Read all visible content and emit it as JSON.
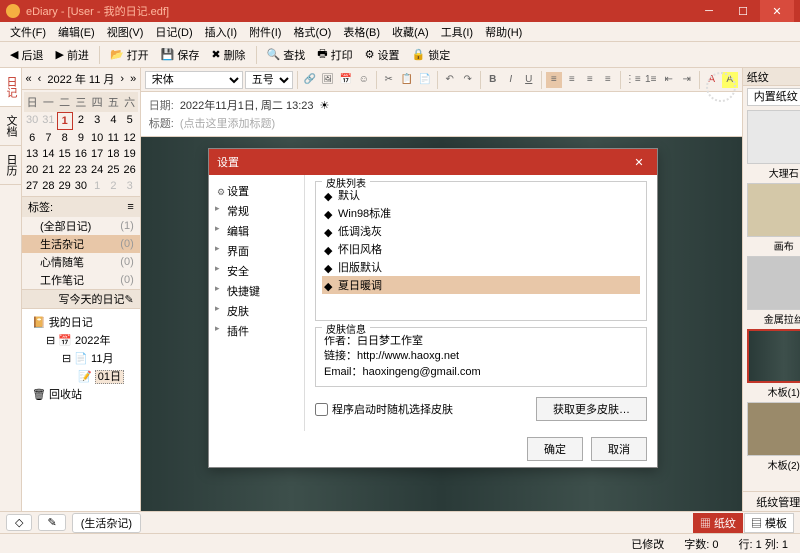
{
  "window": {
    "title": "eDiary - [User - 我的日记.edf]",
    "min": "─",
    "max": "☐",
    "close": "✕"
  },
  "menu": [
    "文件(F)",
    "编辑(E)",
    "视图(V)",
    "日记(D)",
    "插入(I)",
    "附件(I)",
    "格式(O)",
    "表格(B)",
    "收藏(A)",
    "工具(I)",
    "帮助(H)"
  ],
  "toolbar": {
    "back": "后退",
    "fwd": "前进",
    "open": "打开",
    "save": "保存",
    "del": "删除",
    "find": "查找",
    "print": "打印",
    "config": "设置",
    "lock": "锁定"
  },
  "calendar": {
    "title": "2022 年 11 月",
    "weekdays": [
      "日",
      "一",
      "二",
      "三",
      "四",
      "五",
      "六"
    ],
    "cells": [
      {
        "n": 30,
        "dim": true
      },
      {
        "n": 31,
        "dim": true
      },
      {
        "n": 1,
        "today": true
      },
      {
        "n": 2
      },
      {
        "n": 3
      },
      {
        "n": 4
      },
      {
        "n": 5
      },
      {
        "n": 6
      },
      {
        "n": 7
      },
      {
        "n": 8
      },
      {
        "n": 9
      },
      {
        "n": 10
      },
      {
        "n": 11
      },
      {
        "n": 12
      },
      {
        "n": 13
      },
      {
        "n": 14
      },
      {
        "n": 15
      },
      {
        "n": 16
      },
      {
        "n": 17
      },
      {
        "n": 18
      },
      {
        "n": 19
      },
      {
        "n": 20
      },
      {
        "n": 21
      },
      {
        "n": 22
      },
      {
        "n": 23
      },
      {
        "n": 24
      },
      {
        "n": 25
      },
      {
        "n": 26
      },
      {
        "n": 27
      },
      {
        "n": 28
      },
      {
        "n": 29
      },
      {
        "n": 30
      },
      {
        "n": 1,
        "dim": true
      },
      {
        "n": 2,
        "dim": true
      },
      {
        "n": 3,
        "dim": true
      }
    ]
  },
  "tags": {
    "header": "标签:",
    "items": [
      {
        "name": "(全部日记)",
        "count": "(1)"
      },
      {
        "name": "生活杂记",
        "count": "(0)",
        "sel": true
      },
      {
        "name": "心情随笔",
        "count": "(0)"
      },
      {
        "name": "工作笔记",
        "count": "(0)"
      }
    ],
    "write": "写今天的日记"
  },
  "tree": {
    "root": "我的日记",
    "year": "2022年",
    "month": "11月",
    "day": "01日",
    "recycle": "回收站"
  },
  "lefttabs": [
    "日记",
    "文档",
    "日历"
  ],
  "editor": {
    "font": "宋体",
    "size": "五号",
    "dateLabel": "日期:",
    "dateVal": "2022年11月1日, 周二  13:23",
    "titleLabel": "标题:",
    "titlePh": "(点击这里添加标题)"
  },
  "right": {
    "header": "纸纹",
    "selector": "内置纸纹",
    "thumbs": [
      {
        "name": "大理石"
      },
      {
        "name": "画布"
      },
      {
        "name": "金属拉丝"
      },
      {
        "name": "木板(1)",
        "sel": true
      },
      {
        "name": "木板(2)"
      }
    ],
    "manager": "纸纹管理器"
  },
  "bottomtabs": {
    "a": "◇",
    "b": "✎",
    "c": "(生活杂记)"
  },
  "status": {
    "modified": "已修改",
    "chars": "字数: 0",
    "pos": "行: 1  列: 1",
    "tab1": "纸纹",
    "tab2": "模板"
  },
  "dialog": {
    "title": "设置",
    "tree": {
      "root": "设置",
      "items": [
        "常规",
        "编辑",
        "界面",
        "安全",
        "快捷键",
        "皮肤",
        "插件"
      ]
    },
    "skinlistLabel": "皮肤列表",
    "skins": [
      "默认",
      "Win98标准",
      "低调浅灰",
      "怀旧风格",
      "旧版默认",
      "夏日暖调"
    ],
    "skinSel": 5,
    "infoLabel": "皮肤信息",
    "infoAuthor": "作者：白日梦工作室",
    "infoLink": "链接：http://www.haoxg.net",
    "infoEmail": "Email：haoxingeng@gmail.com",
    "randChk": "程序启动时随机选择皮肤",
    "getMore": "获取更多皮肤…",
    "ok": "确定",
    "cancel": "取消"
  }
}
